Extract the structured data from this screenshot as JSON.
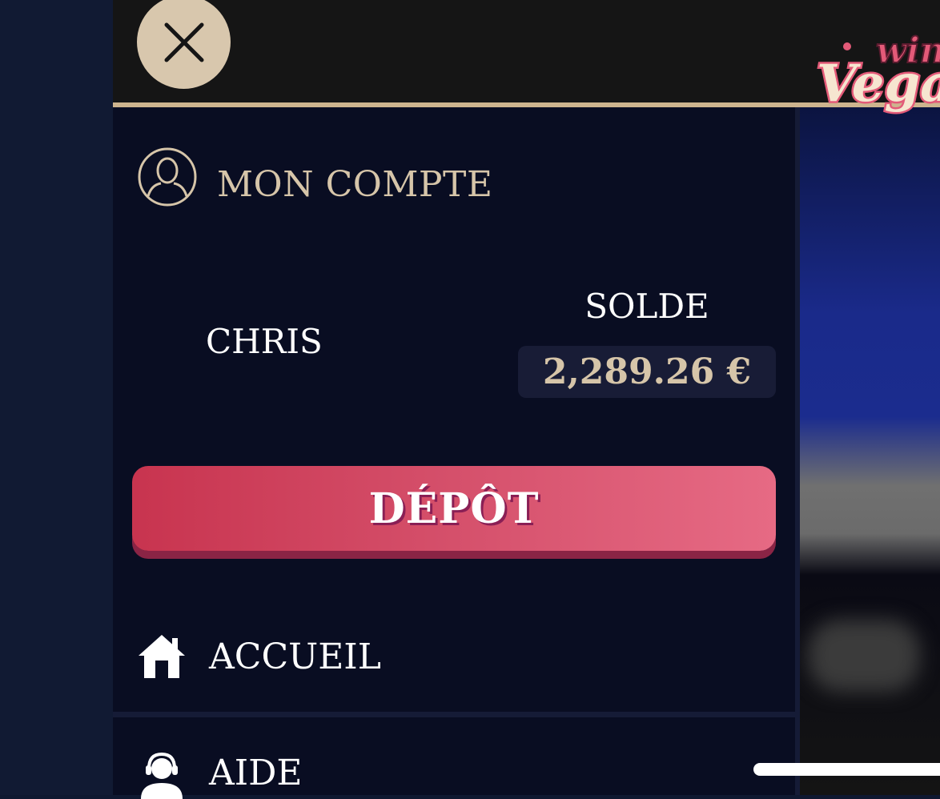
{
  "header": {
    "close_icon": "close-icon",
    "logo_text_top": "win",
    "logo_text_main": "Vegas"
  },
  "account": {
    "title": "MON COMPTE",
    "icon": "user-circle-icon",
    "username": "CHRIS",
    "balance_label": "SOLDE",
    "balance_value": "2,289.26 €"
  },
  "deposit": {
    "label": "DÉPÔT"
  },
  "menu": {
    "items": [
      {
        "label": "ACCUEIL",
        "icon": "home-icon"
      },
      {
        "label": "AIDE",
        "icon": "support-headset-icon"
      }
    ]
  },
  "colors": {
    "accent_gold": "#cdb48e",
    "panel_bg": "#090d22",
    "deposit_start": "#c8344f",
    "deposit_end": "#e66a84"
  }
}
